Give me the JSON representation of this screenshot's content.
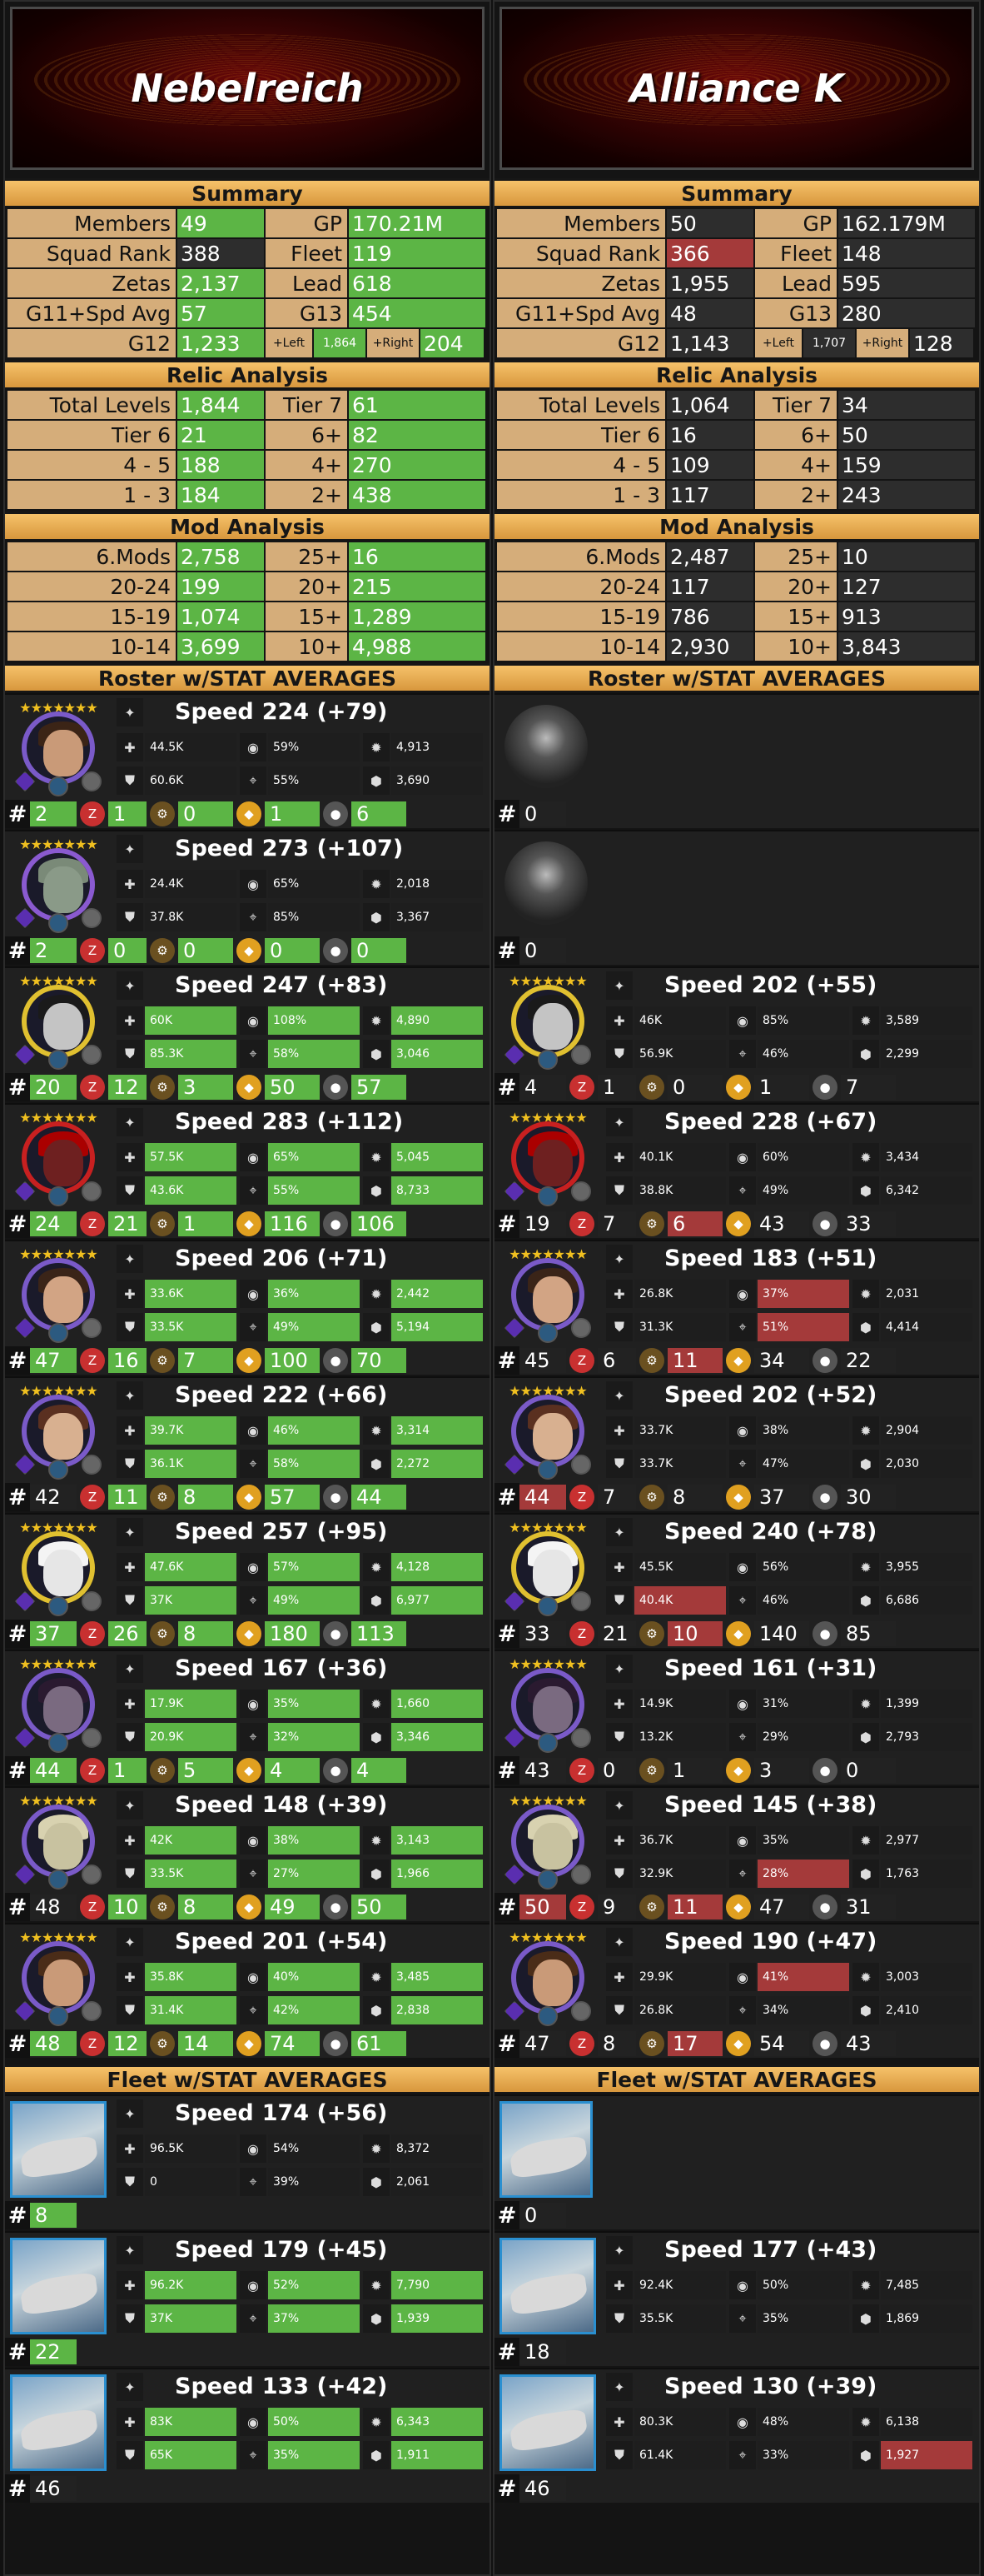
{
  "left": {
    "guild_name": "Nebelreich",
    "summary_title": "Summary",
    "summary": {
      "members_label": "Members",
      "members": "49",
      "gp_label": "GP",
      "gp": "170.21M",
      "squad_label": "Squad Rank",
      "squad": "388",
      "fleet_label": "Fleet",
      "fleet": "119",
      "zetas_label": "Zetas",
      "zetas": "2,137",
      "lead_label": "Lead",
      "lead": "618",
      "g11_label": "G11+Spd Avg",
      "g11": "57",
      "g13_label": "G13",
      "g13": "454",
      "g12_label": "G12",
      "g12": "1,233",
      "left_label": "+Left",
      "left": "1,864",
      "right_label": "+Right",
      "right": "204"
    },
    "relic_title": "Relic Analysis",
    "relic": [
      [
        "Total Levels",
        "1,844",
        "Tier 7",
        "61"
      ],
      [
        "Tier 6",
        "21",
        "6+",
        "82"
      ],
      [
        "4 - 5",
        "188",
        "4+",
        "270"
      ],
      [
        "1 - 3",
        "184",
        "2+",
        "438"
      ]
    ],
    "mod_title": "Mod Analysis",
    "mods": [
      [
        "6.Mods",
        "2,758",
        "25+",
        "16"
      ],
      [
        "20-24",
        "199",
        "20+",
        "215"
      ],
      [
        "15-19",
        "1,074",
        "15+",
        "1,289"
      ],
      [
        "10-14",
        "3,699",
        "10+",
        "4,988"
      ]
    ],
    "roster_title": "Roster w/STAT AVERAGES",
    "fleet_title": "Fleet w/STAT AVERAGES"
  },
  "right": {
    "guild_name": "Alliance K",
    "summary_title": "Summary",
    "summary": {
      "members_label": "Members",
      "members": "50",
      "gp_label": "GP",
      "gp": "162.179M",
      "squad_label": "Squad Rank",
      "squad": "366",
      "fleet_label": "Fleet",
      "fleet": "148",
      "zetas_label": "Zetas",
      "zetas": "1,955",
      "lead_label": "Lead",
      "lead": "595",
      "g11_label": "G11+Spd Avg",
      "g11": "48",
      "g13_label": "G13",
      "g13": "280",
      "g12_label": "G12",
      "g12": "1,143",
      "left_label": "+Left",
      "left": "1,707",
      "right_label": "+Right",
      "right": "128"
    },
    "relic_title": "Relic Analysis",
    "relic": [
      [
        "Total Levels",
        "1,064",
        "Tier 7",
        "34"
      ],
      [
        "Tier 6",
        "16",
        "6+",
        "50"
      ],
      [
        "4 - 5",
        "109",
        "4+",
        "159"
      ],
      [
        "1 - 3",
        "117",
        "2+",
        "243"
      ]
    ],
    "mod_title": "Mod Analysis",
    "mods": [
      [
        "6.Mods",
        "2,487",
        "25+",
        "10"
      ],
      [
        "20-24",
        "117",
        "20+",
        "127"
      ],
      [
        "15-19",
        "786",
        "15+",
        "913"
      ],
      [
        "10-14",
        "2,930",
        "10+",
        "3,843"
      ]
    ],
    "roster_title": "Roster w/STAT AVERAGES",
    "fleet_title": "Fleet w/STAT AVERAGES"
  },
  "speed_label": "Speed",
  "roster_left": [
    {
      "speed": "224 (+79)",
      "hp": "44.5K",
      "cc": "59%",
      "off": "4,913",
      "prot": "60.6K",
      "pot": "55%",
      "sp": "3,690",
      "count": "2",
      "g1": "1",
      "g2": "0",
      "g3": "1",
      "g4": "6",
      "hi": false
    },
    {
      "speed": "273 (+107)",
      "hp": "24.4K",
      "cc": "65%",
      "off": "2,018",
      "prot": "37.8K",
      "pot": "85%",
      "sp": "3,367",
      "count": "2",
      "g1": "0",
      "g2": "0",
      "g3": "0",
      "g4": "0",
      "hi": false
    },
    {
      "speed": "247 (+83)",
      "hp": "60K",
      "cc": "108%",
      "off": "4,890",
      "prot": "85.3K",
      "pot": "58%",
      "sp": "3,046",
      "count": "20",
      "g1": "12",
      "g2": "3",
      "g3": "50",
      "g4": "57",
      "hi": true
    },
    {
      "speed": "283 (+112)",
      "hp": "57.5K",
      "cc": "65%",
      "off": "5,045",
      "prot": "43.6K",
      "pot": "55%",
      "sp": "8,733",
      "count": "24",
      "g1": "21",
      "g2": "1",
      "g3": "116",
      "g4": "106",
      "hi": true
    },
    {
      "speed": "206 (+71)",
      "hp": "33.6K",
      "cc": "36%",
      "off": "2,442",
      "prot": "33.5K",
      "pot": "49%",
      "sp": "5,194",
      "count": "47",
      "g1": "16",
      "g2": "7",
      "g3": "100",
      "g4": "70",
      "hi": true
    },
    {
      "speed": "222 (+66)",
      "hp": "39.7K",
      "cc": "46%",
      "off": "3,314",
      "prot": "36.1K",
      "pot": "58%",
      "sp": "2,272",
      "count": "42",
      "g1": "11",
      "g2": "8",
      "g3": "57",
      "g4": "44",
      "hi": true
    },
    {
      "speed": "257 (+95)",
      "hp": "47.6K",
      "cc": "57%",
      "off": "4,128",
      "prot": "37K",
      "pot": "49%",
      "sp": "6,977",
      "count": "37",
      "g1": "26",
      "g2": "8",
      "g3": "180",
      "g4": "113",
      "hi": true
    },
    {
      "speed": "167 (+36)",
      "hp": "17.9K",
      "cc": "35%",
      "off": "1,660",
      "prot": "20.9K",
      "pot": "32%",
      "sp": "3,346",
      "count": "44",
      "g1": "1",
      "g2": "5",
      "g3": "4",
      "g4": "4",
      "hi": true
    },
    {
      "speed": "148 (+39)",
      "hp": "42K",
      "cc": "38%",
      "off": "3,143",
      "prot": "33.5K",
      "pot": "27%",
      "sp": "1,966",
      "count": "48",
      "g1": "10",
      "g2": "8",
      "g3": "49",
      "g4": "50",
      "hi": true
    },
    {
      "speed": "201 (+54)",
      "hp": "35.8K",
      "cc": "40%",
      "off": "3,485",
      "prot": "31.4K",
      "pot": "42%",
      "sp": "2,838",
      "count": "48",
      "g1": "12",
      "g2": "14",
      "g3": "74",
      "g4": "61",
      "hi": true
    }
  ],
  "roster_right": [
    {
      "empty": true,
      "count": "0"
    },
    {
      "empty": true,
      "count": "0"
    },
    {
      "speed": "202 (+55)",
      "hp": "46K",
      "cc": "85%",
      "off": "3,589",
      "prot": "56.9K",
      "pot": "46%",
      "sp": "2,299",
      "count": "4",
      "g1": "1",
      "g2": "0",
      "g3": "1",
      "g4": "7"
    },
    {
      "speed": "228 (+67)",
      "hp": "40.1K",
      "cc": "60%",
      "off": "3,434",
      "prot": "38.8K",
      "pot": "49%",
      "sp": "6,342",
      "count": "19",
      "g1": "7",
      "g2": "6",
      "g3": "43",
      "g4": "33"
    },
    {
      "speed": "183 (+51)",
      "hp": "26.8K",
      "cc": "37%",
      "off": "2,031",
      "prot": "31.3K",
      "pot": "51%",
      "sp": "4,414",
      "count": "45",
      "g1": "6",
      "g2": "11",
      "g3": "34",
      "g4": "22"
    },
    {
      "speed": "202 (+52)",
      "hp": "33.7K",
      "cc": "38%",
      "off": "2,904",
      "prot": "33.7K",
      "pot": "47%",
      "sp": "2,030",
      "count": "44",
      "g1": "7",
      "g2": "8",
      "g3": "37",
      "g4": "30"
    },
    {
      "speed": "240 (+78)",
      "hp": "45.5K",
      "cc": "56%",
      "off": "3,955",
      "prot": "40.4K",
      "pot": "46%",
      "sp": "6,686",
      "count": "33",
      "g1": "21",
      "g2": "10",
      "g3": "140",
      "g4": "85"
    },
    {
      "speed": "161 (+31)",
      "hp": "14.9K",
      "cc": "31%",
      "off": "1,399",
      "prot": "13.2K",
      "pot": "29%",
      "sp": "2,793",
      "count": "43",
      "g1": "0",
      "g2": "1",
      "g3": "3",
      "g4": "0"
    },
    {
      "speed": "145 (+38)",
      "hp": "36.7K",
      "cc": "35%",
      "off": "2,977",
      "prot": "32.9K",
      "pot": "28%",
      "sp": "1,763",
      "count": "50",
      "g1": "9",
      "g2": "11",
      "g3": "47",
      "g4": "31"
    },
    {
      "speed": "190 (+47)",
      "hp": "29.9K",
      "cc": "41%",
      "off": "3,003",
      "prot": "26.8K",
      "pot": "34%",
      "sp": "2,410",
      "count": "47",
      "g1": "8",
      "g2": "17",
      "g3": "54",
      "g4": "43"
    }
  ],
  "fleet_left": [
    {
      "speed": "174 (+56)",
      "hp": "96.5K",
      "cc": "54%",
      "off": "8,372",
      "prot": "0",
      "pot": "39%",
      "sp": "2,061",
      "count": "8"
    },
    {
      "speed": "179 (+45)",
      "hp": "96.2K",
      "cc": "52%",
      "off": "7,790",
      "prot": "37K",
      "pot": "37%",
      "sp": "1,939",
      "count": "22"
    },
    {
      "speed": "133 (+42)",
      "hp": "83K",
      "cc": "50%",
      "off": "6,343",
      "prot": "65K",
      "pot": "35%",
      "sp": "1,911",
      "count": "46"
    }
  ],
  "fleet_right": [
    {
      "empty": true,
      "count": "0"
    },
    {
      "speed": "177 (+43)",
      "hp": "92.4K",
      "cc": "50%",
      "off": "7,485",
      "prot": "35.5K",
      "pot": "35%",
      "sp": "1,869",
      "count": "18"
    },
    {
      "speed": "130 (+39)",
      "hp": "80.3K",
      "cc": "48%",
      "off": "6,138",
      "prot": "61.4K",
      "pot": "33%",
      "sp": "1,927",
      "count": "46"
    }
  ],
  "colors": {
    "green": "#5cb545",
    "dark": "#2d2d2d",
    "red": "#a43a3a",
    "label": "#d5ad7a",
    "header": "#e6ad55"
  },
  "icons": [
    "speed-icon",
    "health-icon",
    "crit-chance-icon",
    "offense-icon",
    "protection-icon",
    "potency-icon",
    "special-icon",
    "hash-icon",
    "zeta-icon",
    "gear-icon",
    "relic-icon"
  ]
}
